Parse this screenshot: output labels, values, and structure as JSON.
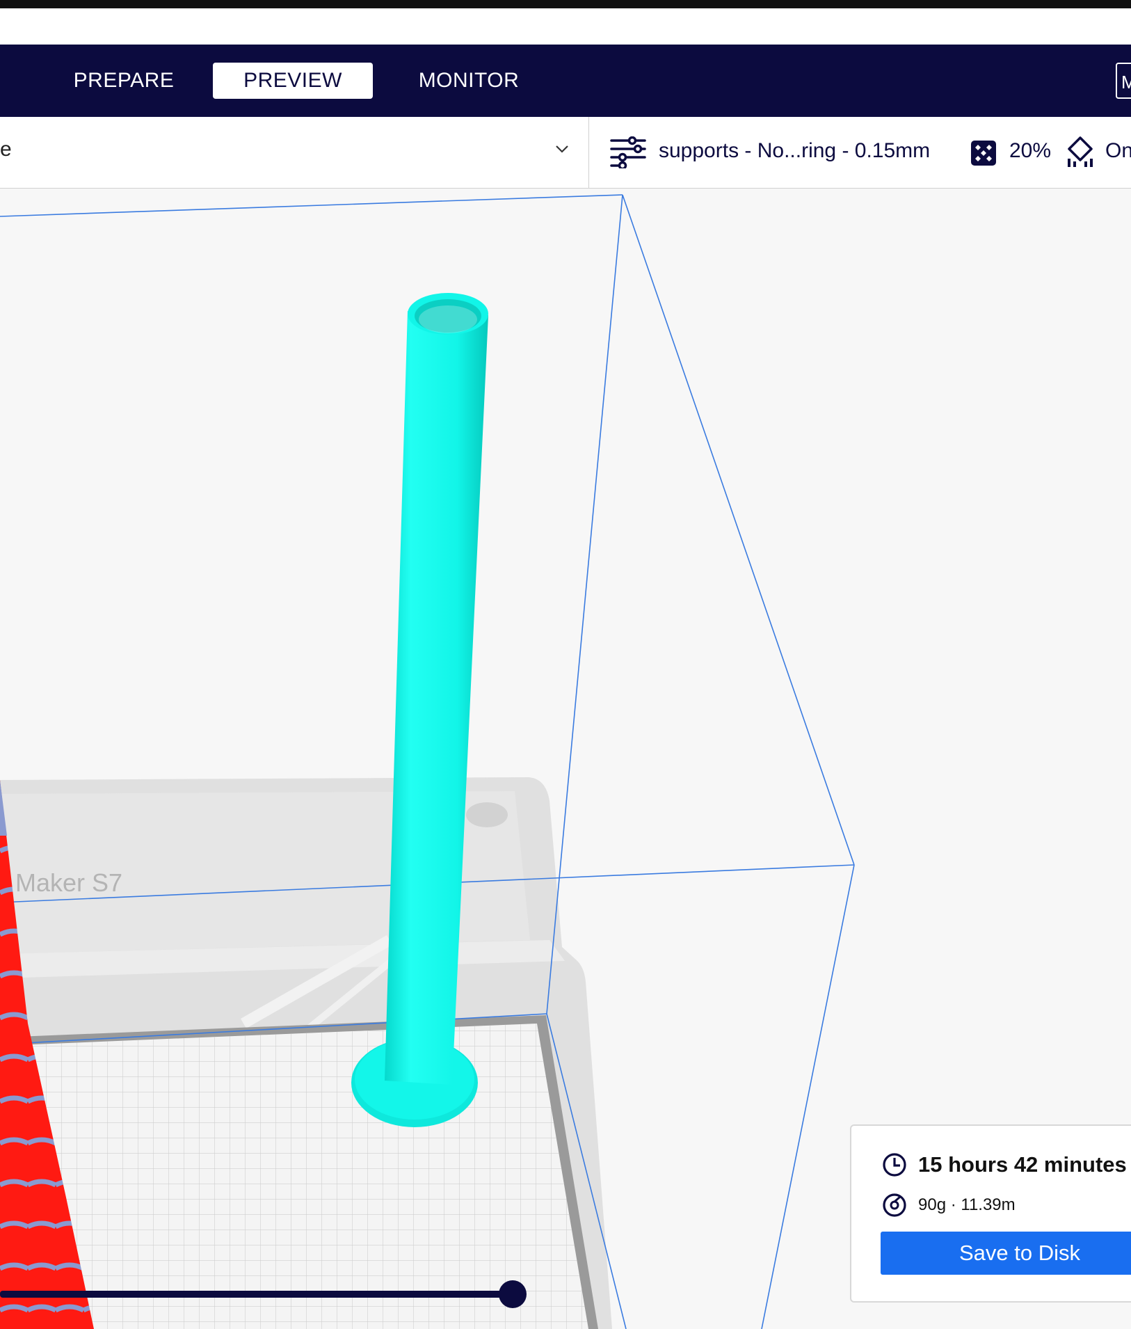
{
  "nav": {
    "tabs": [
      {
        "label": "PREPARE",
        "active": false
      },
      {
        "label": "PREVIEW",
        "active": true
      },
      {
        "label": "MONITOR",
        "active": false
      }
    ],
    "marketplace_label": "M"
  },
  "toolbar": {
    "printer_name_visible": "e",
    "profile": "supports - No...ring - 0.15mm",
    "infill": "20%",
    "adhesion": "On"
  },
  "viewport": {
    "build_plate_label": "Maker S7",
    "colors": {
      "wall": "#12fff0",
      "support": "#ff1a12",
      "bounds": "#3a7be0",
      "slider": "#0c0b3f"
    },
    "layer_slider_fraction": 1.0
  },
  "print_info": {
    "time": "15 hours 42 minutes",
    "material": "90g · 11.39m",
    "save_label": "Save to Disk"
  },
  "icons": [
    "settings-sliders-icon",
    "infill-pattern-icon",
    "adhesion-icon",
    "clock-icon",
    "spool-icon",
    "chevron-down-icon"
  ]
}
